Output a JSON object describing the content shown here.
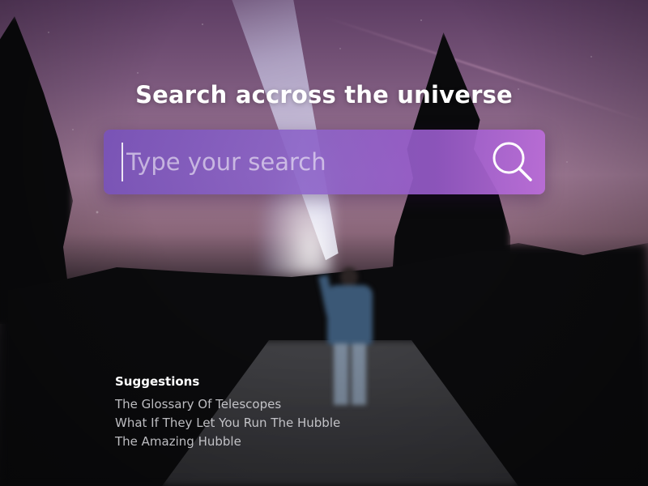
{
  "page": {
    "heading": "Search accross the universe"
  },
  "search": {
    "placeholder": "Type your search",
    "value": "",
    "button_icon": "search-icon"
  },
  "suggestions": {
    "title": "Suggestions",
    "items": [
      {
        "label": "The Glossary Of Telescopes"
      },
      {
        "label": "What If They Let You Run The Hubble"
      },
      {
        "label": "The Amazing Hubble"
      }
    ]
  },
  "colors": {
    "accent_start": "#7852b9",
    "accent_end": "#b96cd7",
    "text_primary": "#ffffff"
  }
}
